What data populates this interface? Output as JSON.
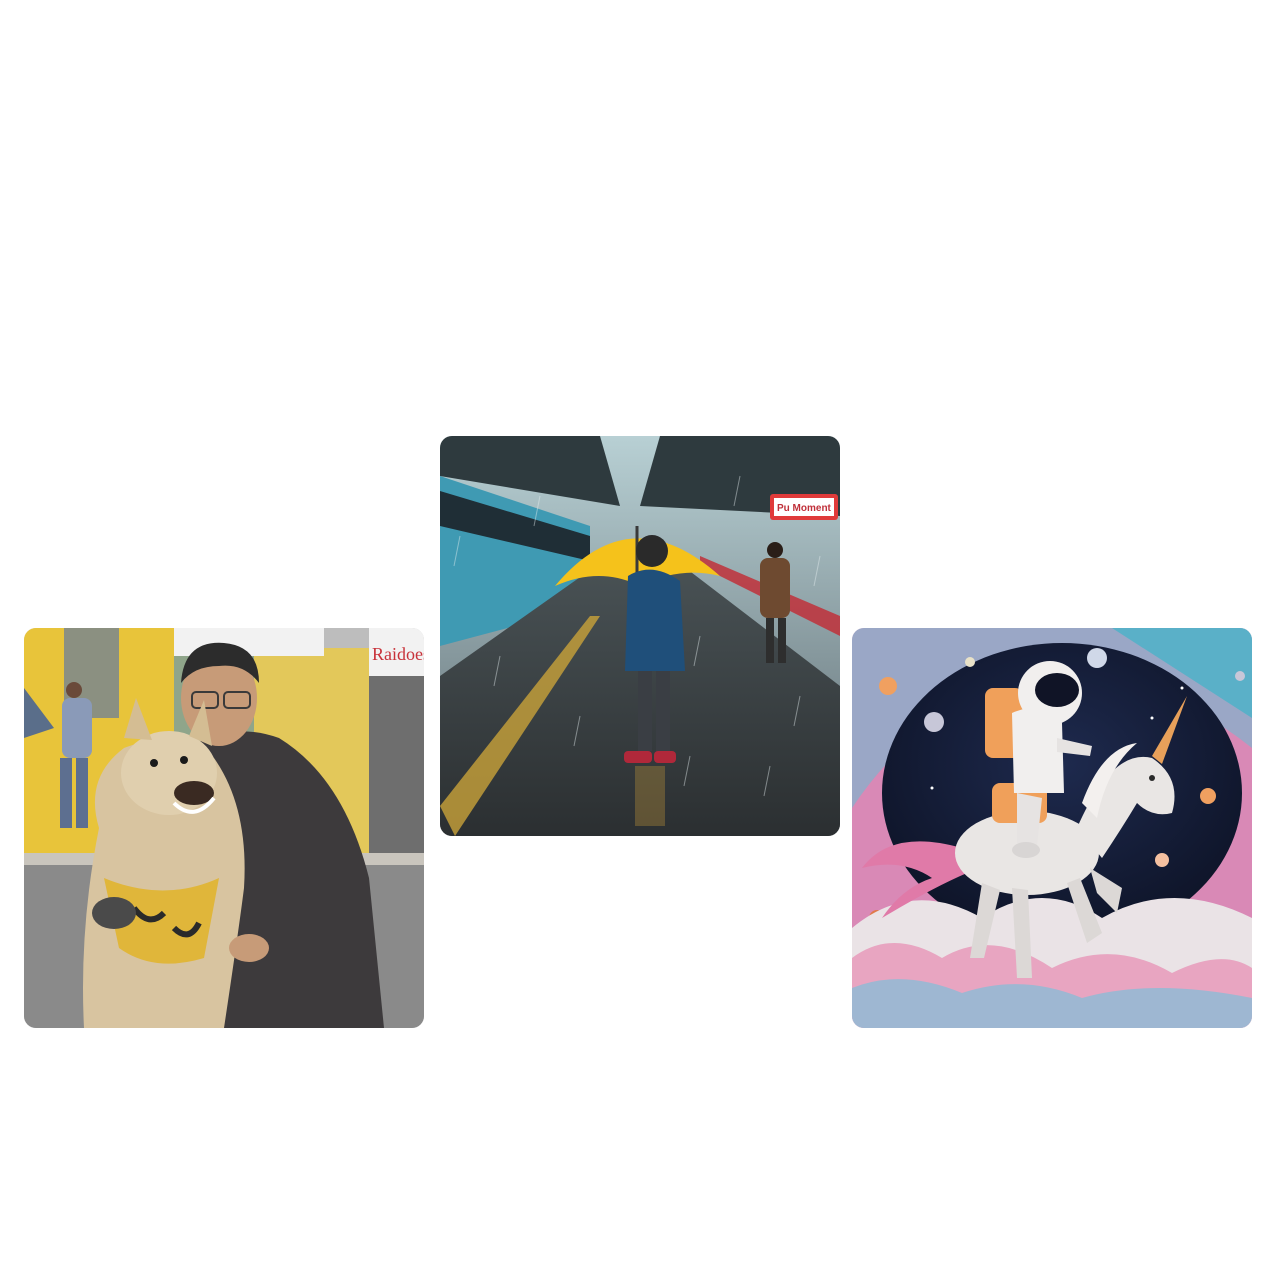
{
  "gallery": {
    "images": [
      {
        "subject": "man-with-dog",
        "sign_text": "Raidoes",
        "colors": {
          "wall": "#e8c43a",
          "jacket": "#3d3a3c",
          "dog": "#d8c4a0",
          "bandana": "#e0b63a"
        }
      },
      {
        "subject": "child-with-umbrella-on-rainy-platform",
        "sign_text": "Pu Moment",
        "colors": {
          "sky": "#a9c6cc",
          "train": "#3f9ab3",
          "umbrella": "#f5c21b",
          "raincoat": "#1f4f7a",
          "sign": "#e03a3a"
        }
      },
      {
        "subject": "astronaut-riding-unicorn-in-space",
        "colors": {
          "space": "#141b36",
          "nebula": "#e07aa8",
          "unicorn": "#e9e6e4",
          "horn": "#e7a05a",
          "backpack": "#f0a05a"
        }
      }
    ]
  }
}
